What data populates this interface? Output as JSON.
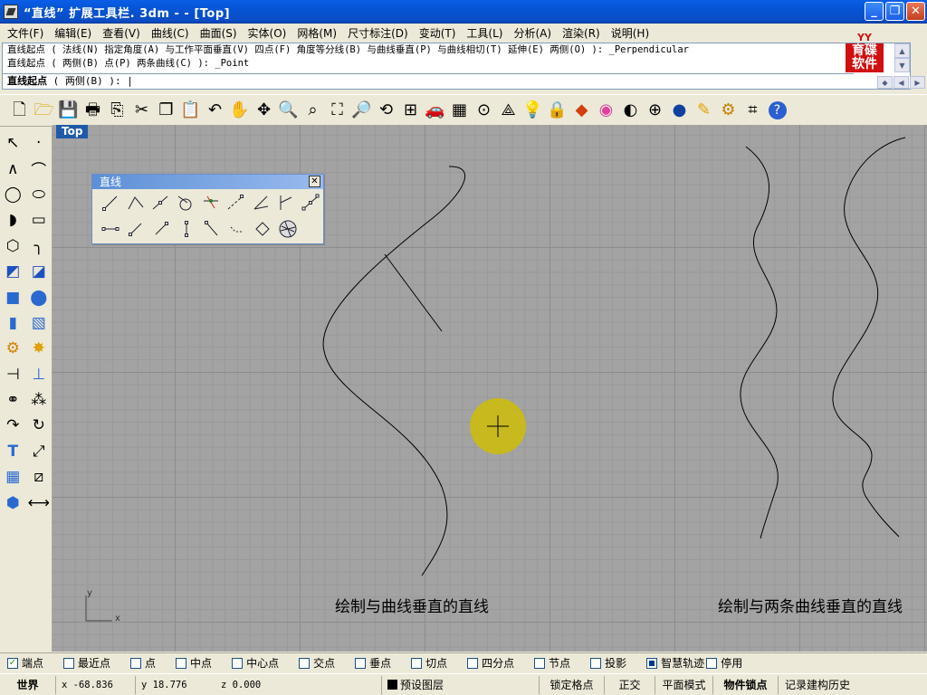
{
  "window": {
    "title": "“直线” 扩展工具栏. 3dm -  - [Top]",
    "minimize": "_",
    "maximize": "❐",
    "close": "✕"
  },
  "menu": [
    "文件(F)",
    "编辑(E)",
    "查看(V)",
    "曲线(C)",
    "曲面(S)",
    "实体(O)",
    "网格(M)",
    "尺寸标注(D)",
    "变动(T)",
    "工具(L)",
    "分析(A)",
    "渲染(R)",
    "说明(H)"
  ],
  "command": {
    "history": [
      "直线起点 ( 法线(N)  指定角度(A)  与工作平面垂直(V)  四点(F)  角度等分线(B)  与曲线垂直(P)  与曲线相切(T)  延伸(E)  两侧(O) ): _Perpendicular",
      "直线起点 ( 两侧(B)  点(P)  两条曲线(C) ): _Point"
    ],
    "prompt_bold": "直线起点",
    "prompt_rest": " ( 两侧(B) ): |"
  },
  "logo": {
    "top": "YY",
    "line1": "育碟",
    "line2": "软件"
  },
  "toolbar_icons": [
    "new-file-icon",
    "open-folder-icon",
    "save-icon",
    "print-icon",
    "import-icon",
    "cut-icon",
    "copy-icon",
    "paste-icon",
    "undo-icon",
    "pan-hand-icon",
    "rotate-view-icon",
    "zoom-dynamic-icon",
    "zoom-window-icon",
    "zoom-extents-icon",
    "zoom-selected-icon",
    "undo-view-icon",
    "four-viewports-icon",
    "car-icon",
    "grid-plane-icon",
    "osnap-target-icon",
    "cplane-icon",
    "light-bulb-icon",
    "lock-icon",
    "layer-icon",
    "color-wheel-icon",
    "shade-sphere-icon",
    "wire-sphere-icon",
    "render-sphere-icon",
    "pen-icon",
    "gear-icon",
    "dimension-icon",
    "help-icon"
  ],
  "viewport": {
    "tab": "Top",
    "caption_left": "绘制与曲线垂直的直线",
    "caption_right": "绘制与两条曲线垂直的直线",
    "axis_y": "y",
    "axis_x": "x"
  },
  "line_toolbar": {
    "title": "直线",
    "close": "✕"
  },
  "osnaps": [
    {
      "label": "端点",
      "state": "checked"
    },
    {
      "label": "最近点",
      "state": "off"
    },
    {
      "label": "点",
      "state": "off"
    },
    {
      "label": "中点",
      "state": "off"
    },
    {
      "label": "中心点",
      "state": "off"
    },
    {
      "label": "交点",
      "state": "off"
    },
    {
      "label": "垂点",
      "state": "off"
    },
    {
      "label": "切点",
      "state": "off"
    },
    {
      "label": "四分点",
      "state": "off"
    },
    {
      "label": "节点",
      "state": "off"
    },
    {
      "label": "投影",
      "state": "off"
    },
    {
      "label": "智慧轨迹",
      "state": "square"
    },
    {
      "label": "停用",
      "state": "off"
    }
  ],
  "status": {
    "cplane": "世界",
    "x": "x -68.836",
    "y": "y 18.776",
    "z": "z 0.000",
    "layer": "预设图层",
    "grid_snap": "锁定格点",
    "ortho": "正交",
    "planar": "平面模式",
    "osnap": "物件锁点",
    "history": "记录建构历史"
  },
  "colors": {
    "cursor_highlight": "#d4c000",
    "viewport_bg": "#a3a3a3",
    "titlebar": "#0654d4"
  }
}
